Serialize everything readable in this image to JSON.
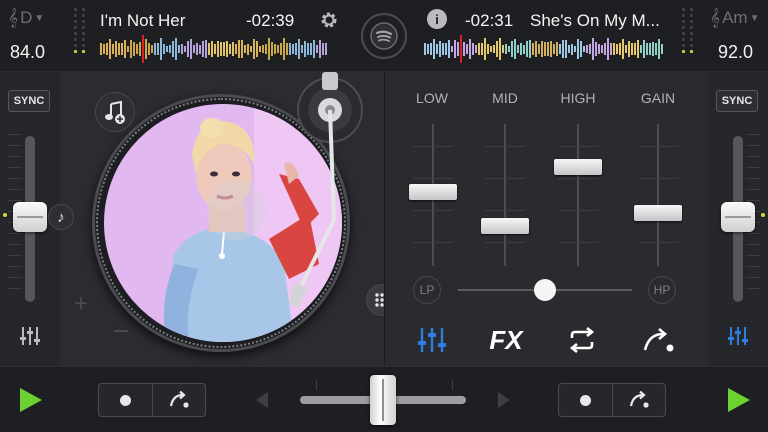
{
  "deck_a": {
    "key": "D",
    "key_icon": "treble-clef-icon",
    "bpm": "84.0",
    "title": "I'm Not Her",
    "time": "-02:39",
    "sync_label": "SYNC",
    "wave_colors": [
      "#d9b25a",
      "#c9a94a",
      "#8db7d8",
      "#b6a2d9",
      "#e2c46a"
    ]
  },
  "deck_b": {
    "key": "Am",
    "key_icon": "treble-clef-icon",
    "bpm": "92.0",
    "title": "She's On My M...",
    "time": "-02:31",
    "sync_label": "SYNC",
    "wave_colors": [
      "#9fc7e6",
      "#c3a8e2",
      "#e5c86b",
      "#8fd0c7",
      "#d2b060"
    ]
  },
  "mixer": {
    "eq": [
      {
        "label": "LOW",
        "level": 0.52
      },
      {
        "label": "MID",
        "level": 0.28
      },
      {
        "label": "HIGH",
        "level": 0.7
      },
      {
        "label": "GAIN",
        "level": 0.37
      }
    ],
    "filter": {
      "lp_label": "LP",
      "hp_label": "HP",
      "level": 0.5
    },
    "tools": {
      "fx_label": "FX"
    }
  },
  "crossfader": {
    "level": 0.5
  },
  "colors": {
    "accent_blue": "#2f7de0",
    "play_green": "#6bd232",
    "waveform_playhead": "#d8202a"
  }
}
